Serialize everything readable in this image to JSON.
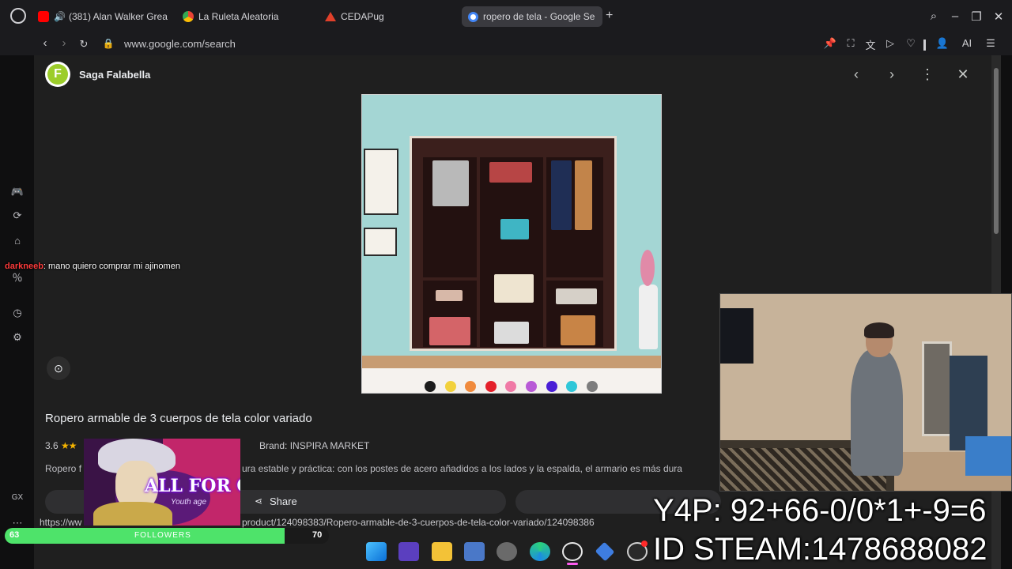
{
  "tabs": [
    {
      "label": "(381) Alan Walker Great",
      "icon": "youtube-icon"
    },
    {
      "label": "La Ruleta Aleatoria",
      "icon": "chrome-icon"
    },
    {
      "label": "CEDAPug",
      "icon": "cedapug-icon"
    },
    {
      "label": "ropero de tela - Google Se",
      "icon": "google-icon",
      "active": true
    }
  ],
  "address": {
    "url": "www.google.com/search"
  },
  "toolbar": {
    "ai_label": "AI"
  },
  "chat": {
    "user": "darkneeb",
    "message": ": mano quiero comprar mi ajinomen"
  },
  "panel": {
    "store_name": "Saga Falabella",
    "store_initial": "F",
    "product_title": "Ropero armable de 3 cuerpos de tela color variado",
    "rating": "3.6",
    "stars": "★★",
    "brand": "Brand: INSPIRA MARKET",
    "desc_pre": "Ropero f",
    "desc_post": "ura estable y práctica: con los postes de acero añadidos a los lados y la espalda, el armario es más dura",
    "share_label": "Share",
    "status_url_pre": "https://ww",
    "status_url": "product/124098383/Ropero-armable-de-3-cuerpos-de-tela-color-variado/124098386",
    "swatches": [
      "#1c1c1c",
      "#f2d13c",
      "#f08a3c",
      "#e4202a",
      "#f07aa6",
      "#b85ad6",
      "#4a1fd6",
      "#2fc7d8",
      "#7d7d7d"
    ]
  },
  "overlay": {
    "anime_title": "ALL FOR ONE",
    "anime_sub": "Youth age",
    "followers_label": "FOLLOWERS",
    "followers_count": "63",
    "followers_goal": "70",
    "followers_progress": 0.9,
    "y4p": "Y4P: 92+66-0/0*1+-9=6",
    "steam_id": "ID STEAM:1478688082",
    "gx_label": "GX"
  }
}
